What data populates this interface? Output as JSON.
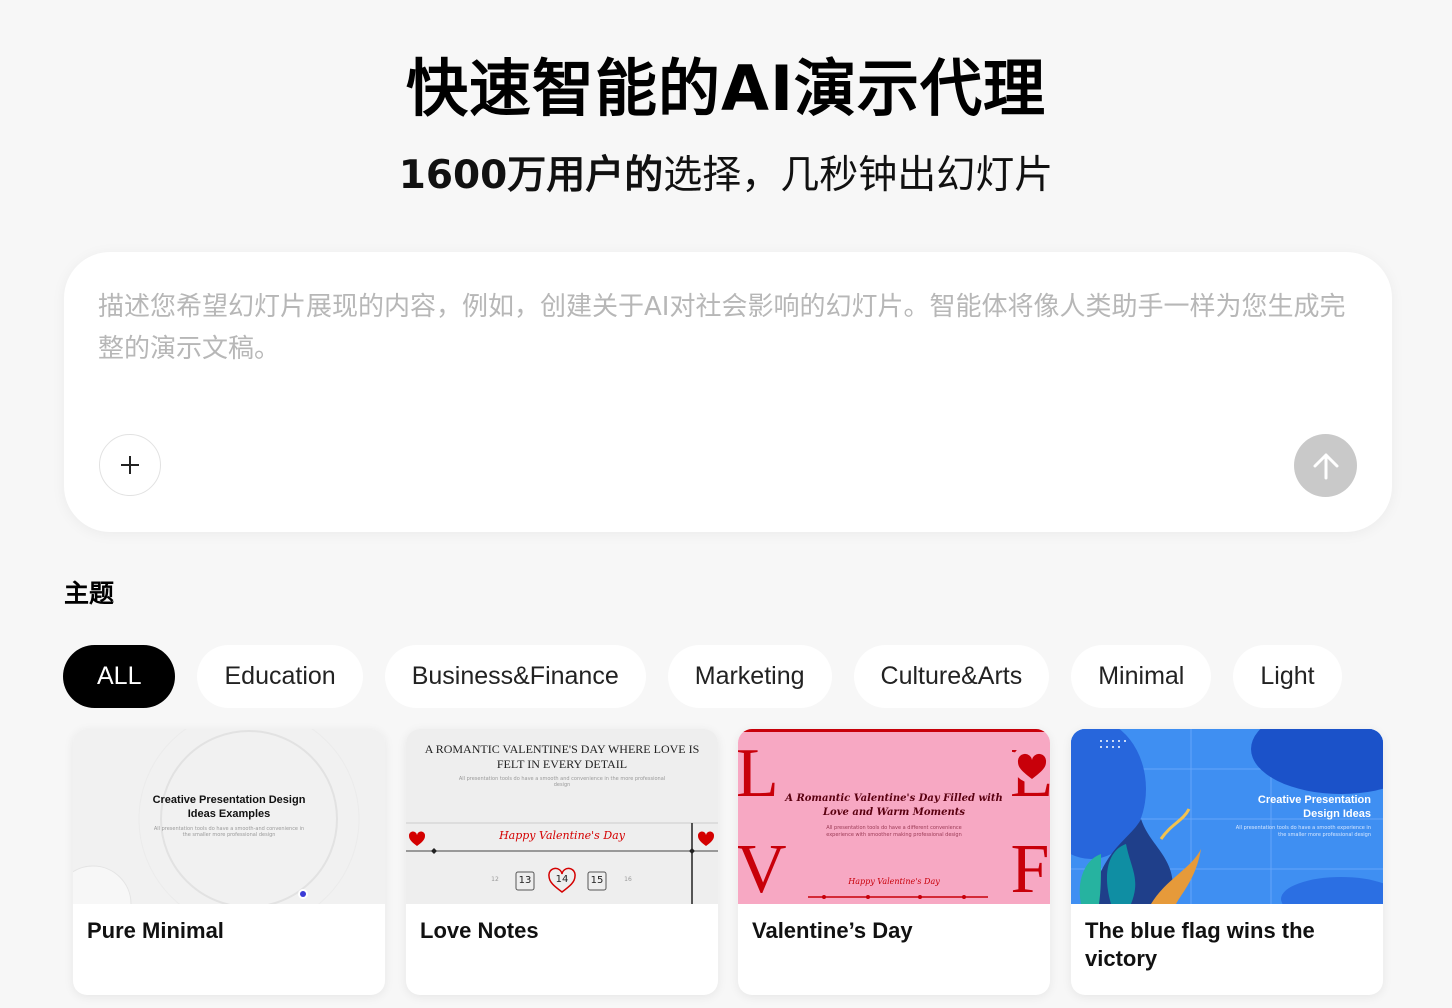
{
  "hero": {
    "title": "快速智能的AI演示代理",
    "subtitle_strong": "1600万用户的",
    "subtitle_rest": "选择，几秒钟出幻灯片"
  },
  "prompt": {
    "placeholder": "描述您希望幻灯片展现的内容，例如，创建关于AI对社会影响的幻灯片。智能体将像人类助手一样为您生成完整的演示文稿。",
    "add_icon": "plus-icon",
    "send_icon": "arrow-up-icon"
  },
  "themes": {
    "title": "主题",
    "chips": [
      {
        "label": "ALL",
        "active": true
      },
      {
        "label": "Education"
      },
      {
        "label": "Business&Finance"
      },
      {
        "label": "Marketing"
      },
      {
        "label": "Culture&Arts"
      },
      {
        "label": "Minimal"
      },
      {
        "label": "Light"
      }
    ]
  },
  "templates": [
    {
      "title": "Pure Minimal",
      "thumb": {
        "heading": "Creative Presentation Design Ideas Examples",
        "body": "All presentation tools do have a smooth-and convenience in the smaller more professional design",
        "colors": {
          "bg": "#f1f1f1",
          "dot": "#3b3bd6"
        }
      }
    },
    {
      "title": "Love Notes",
      "thumb": {
        "heading": "A ROMANTIC VALENTINE'S DAY WHERE LOVE IS FELT IN EVERY DETAIL",
        "body": "All presentation tools do have a smooth and convenience in the more professional design",
        "script": "Happy Valentine's Day",
        "dates": [
          "12",
          "13",
          "14",
          "15",
          "16"
        ],
        "colors": {
          "bg": "#eeeeee",
          "accent": "#d40000"
        }
      }
    },
    {
      "title": "Valentine’s Day",
      "thumb": {
        "heading": "A Romantic Valentine's Day Filled with Love and Warm Moments",
        "body": "All presentation tools do have a different convenience experience with smoother making professional design",
        "script": "Happy Valentine's Day",
        "letters": [
          "L",
          "V",
          "E",
          "F"
        ],
        "colors": {
          "bg": "#f7a8c3",
          "accent": "#c8000a"
        }
      }
    },
    {
      "title": "The blue flag wins the victory",
      "thumb": {
        "heading": "Creative Presentation Design Ideas",
        "body": "All presentation tools do have a smooth experience in the smaller more professional design",
        "colors": {
          "bg": "#3f8ff2",
          "dark": "#1b52c9"
        }
      }
    }
  ]
}
